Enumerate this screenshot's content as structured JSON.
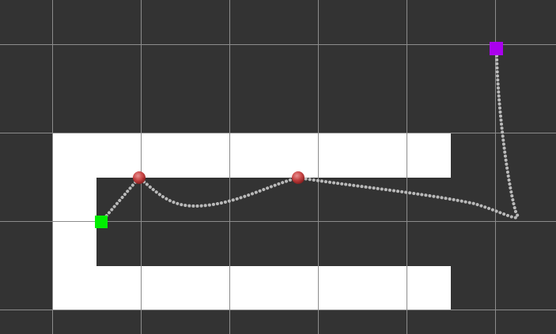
{
  "scene": {
    "description": "path-planning-canvas",
    "colors": {
      "background": "#333333",
      "grid_line": "#8c8c8c",
      "obstacle": "#ffffff",
      "path_dot": "#b9b9b9",
      "start_marker": "#00ee00",
      "goal_marker": "#aa00ee",
      "waypoint_marker": "#cc3333"
    },
    "icons": {
      "start": "green-square",
      "goal": "purple-square",
      "waypoint": "red-sphere"
    }
  }
}
